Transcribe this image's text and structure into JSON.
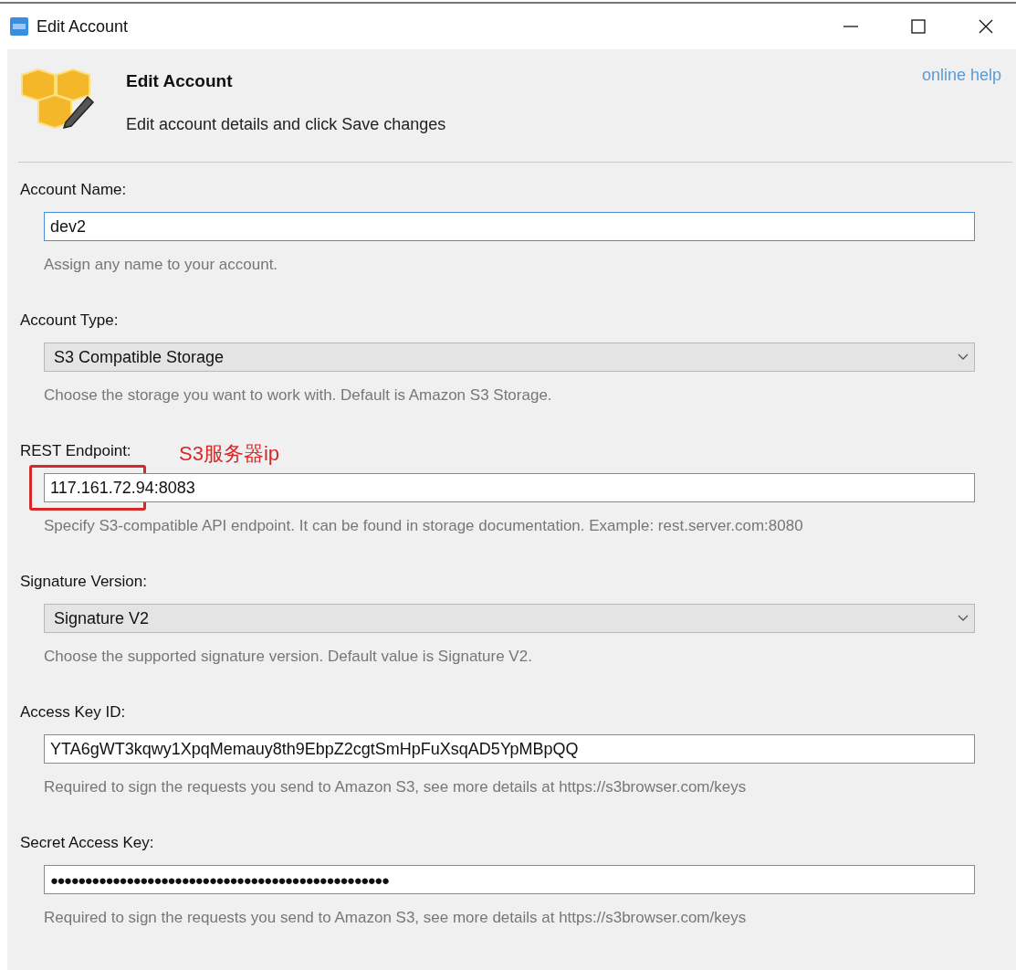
{
  "window": {
    "title": "Edit Account"
  },
  "header": {
    "title": "Edit Account",
    "subtitle": "Edit account details and click Save changes",
    "help_link": "online help"
  },
  "fields": [
    {
      "kind": "text",
      "label": "Account Name:",
      "value": "dev2",
      "focused": true,
      "hint": "Assign any name to your account."
    },
    {
      "kind": "select",
      "label": "Account Type:",
      "value": "S3 Compatible Storage",
      "focused": false,
      "hint": "Choose the storage you want to work with. Default is Amazon S3 Storage."
    },
    {
      "kind": "text",
      "label": "REST Endpoint:",
      "marked_value": "117.161.72.94",
      "value": ":8083",
      "focused": false,
      "annotation": "S3服务器ip",
      "hint": "Specify S3-compatible API endpoint. It can be found in storage documentation. Example: rest.server.com:8080"
    },
    {
      "kind": "select",
      "label": "Signature Version:",
      "value": "Signature V2",
      "focused": false,
      "hint": "Choose the supported signature version. Default value is Signature V2."
    },
    {
      "kind": "text",
      "label": "Access Key ID:",
      "value": "YTA6gWT3kqwy1XpqMemauy8th9EbpZ2cgtSmHpFuXsqAD5YpMBpQQ",
      "focused": false,
      "hint": "Required to sign the requests you send to Amazon S3, see more details at https://s3browser.com/keys"
    },
    {
      "kind": "password",
      "label": "Secret Access Key:",
      "value": "●●●●●●●●●●●●●●●●●●●●●●●●●●●●●●●●●●●●●●●●●●●●●●●●●",
      "focused": false,
      "hint": "Required to sign the requests you send to Amazon S3, see more details at https://s3browser.com/keys"
    }
  ]
}
